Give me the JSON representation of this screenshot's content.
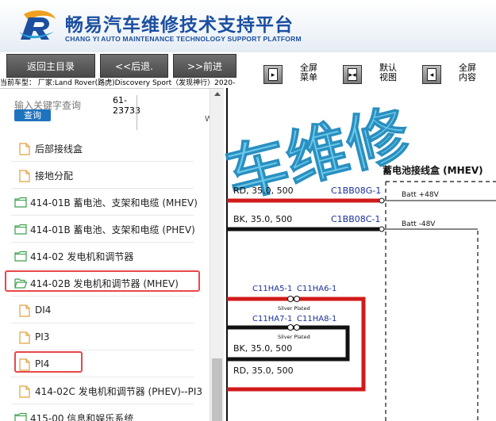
{
  "brand": {
    "title": "畅易汽车维修技术支持平台",
    "subtitle": "CHANG YI AUTO MAINTENANCE TECHNOLOGY SUPPORT PLATFORM"
  },
  "toolbar": {
    "home_label": "返回主目录",
    "back_label": "<<后退.",
    "forward_label": ">>前进",
    "fullscreen_menu_line1": "全屏",
    "fullscreen_menu_line2": "菜单",
    "default_view_line1": "默认",
    "default_view_line2": "视图",
    "fullscreen_content_line1": "全屏",
    "fullscreen_content_line2": "内容"
  },
  "vehicle": {
    "text": "当前车型：  厂家:Land Rover(路虎)Discovery Sport（发现神行）2020-"
  },
  "search": {
    "placeholder": "输入关键字查询",
    "button": "查询",
    "code_line1": "61-",
    "code_line2": "23733",
    "w": "W"
  },
  "tree": [
    {
      "type": "file",
      "label": "后部接线盒"
    },
    {
      "type": "file",
      "label": "接地分配"
    },
    {
      "type": "folder",
      "label": "414-01B 蓄电池、支架和电缆 (MHEV)"
    },
    {
      "type": "folder",
      "label": "414-01B 蓄电池、支架和电缆 (PHEV)"
    },
    {
      "type": "folder",
      "label": "414-02 发电机和调节器"
    },
    {
      "type": "folder-open",
      "label": "414-02B 发电机和调节器 (MHEV)"
    },
    {
      "type": "file",
      "label": "DI4"
    },
    {
      "type": "file",
      "label": "PI3"
    },
    {
      "type": "file",
      "label": "PI4"
    },
    {
      "type": "file",
      "label": "414-02C 发电机和调节器 (PHEV)--PI3"
    },
    {
      "type": "folder",
      "label": "415-00 信息和娱乐系统"
    }
  ],
  "diagram": {
    "watermark": "车维修",
    "box_title": "蓄电池接线盒 (MHEV)",
    "wire1_spec": "RD,  35.0,  500",
    "wire1_conn": "C1BB08G-1",
    "wire1_label": "Batt +48V",
    "wire2_spec": "BK,  35.0,  500",
    "wire2_conn": "C1BB08C-1",
    "wire2_label": "Batt -48V",
    "conn_a1": "C11HA5-1",
    "conn_a2": "C11HA6-1",
    "plated1": "Silver Plated",
    "conn_b1": "C11HA7-1",
    "conn_b2": "C11HA8-1",
    "plated2": "Silver Plated",
    "wire3_spec": "BK,  35.0,  500",
    "wire4_spec": "RD,  35.0,  500",
    "colors": {
      "red": "#d11a1a",
      "black": "#111111",
      "blue": "#1a2f9a",
      "watermark": "#39b6e0"
    }
  }
}
